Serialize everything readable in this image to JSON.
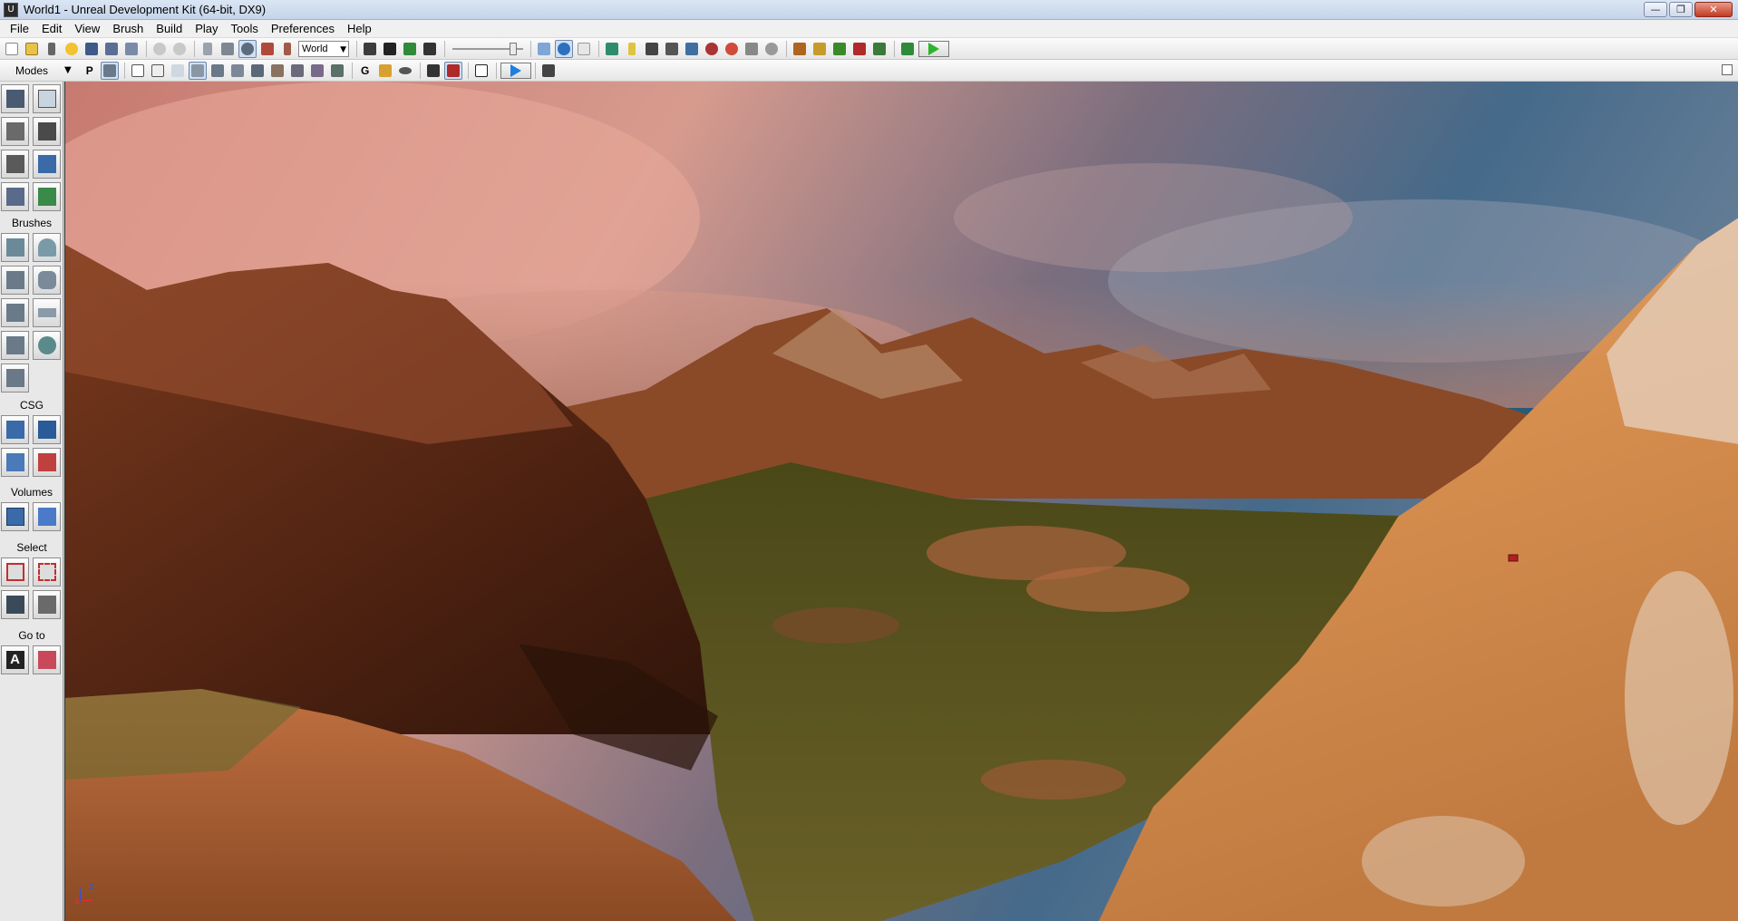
{
  "window": {
    "title": "World1 - Unreal Development Kit (64-bit, DX9)",
    "app_icon": "U",
    "controls": {
      "minimize": "—",
      "restore": "❐",
      "close": "✕"
    }
  },
  "menu": [
    "File",
    "Edit",
    "View",
    "Brush",
    "Build",
    "Play",
    "Tools",
    "Preferences",
    "Help"
  ],
  "toolbar": {
    "coord_system": "World",
    "slider_level": 0.9
  },
  "modes_bar": {
    "label": "Modes",
    "dropdown": "▼",
    "p_label": "P",
    "g_label": "G"
  },
  "panel": {
    "sections": {
      "brushes": "Brushes",
      "csg": "CSG",
      "volumes": "Volumes",
      "select": "Select",
      "goto": "Go to"
    },
    "goto_a": "A"
  },
  "viewport": {
    "axes": {
      "x": "x",
      "z": "z"
    }
  },
  "colors": {
    "sky_pink": "#d48a7a",
    "sky_blue": "#3b6688",
    "rock": "#a0562c",
    "grass": "#5a5420",
    "sand": "#d89a5a"
  }
}
